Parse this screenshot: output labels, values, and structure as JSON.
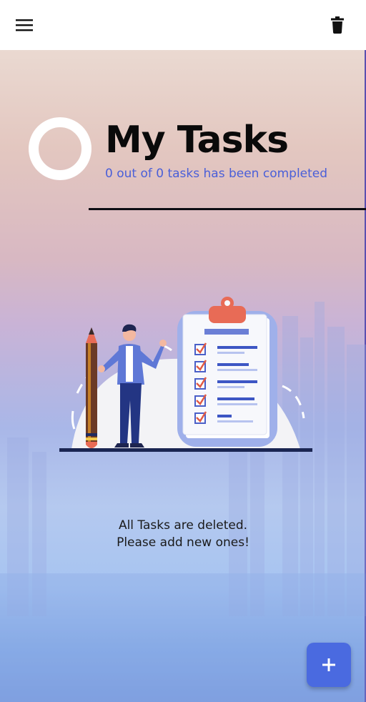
{
  "appbar": {
    "menu_icon": "hamburger-menu-icon",
    "delete_icon": "trash-icon"
  },
  "header": {
    "title": "My Tasks",
    "progress_text": "0 out of 0 tasks has been completed",
    "completed_count": 0,
    "total_count": 0,
    "progress_fraction": 0
  },
  "empty_state": {
    "line1": "All Tasks are deleted.",
    "line2": "Please add new ones!",
    "illustration": "person-with-pencil-and-checklist-clipboard"
  },
  "fab": {
    "icon": "plus-icon"
  },
  "colors": {
    "accent": "#4a6ae0",
    "subtitle": "#4a5fd8",
    "title": "#0a0a0a"
  }
}
